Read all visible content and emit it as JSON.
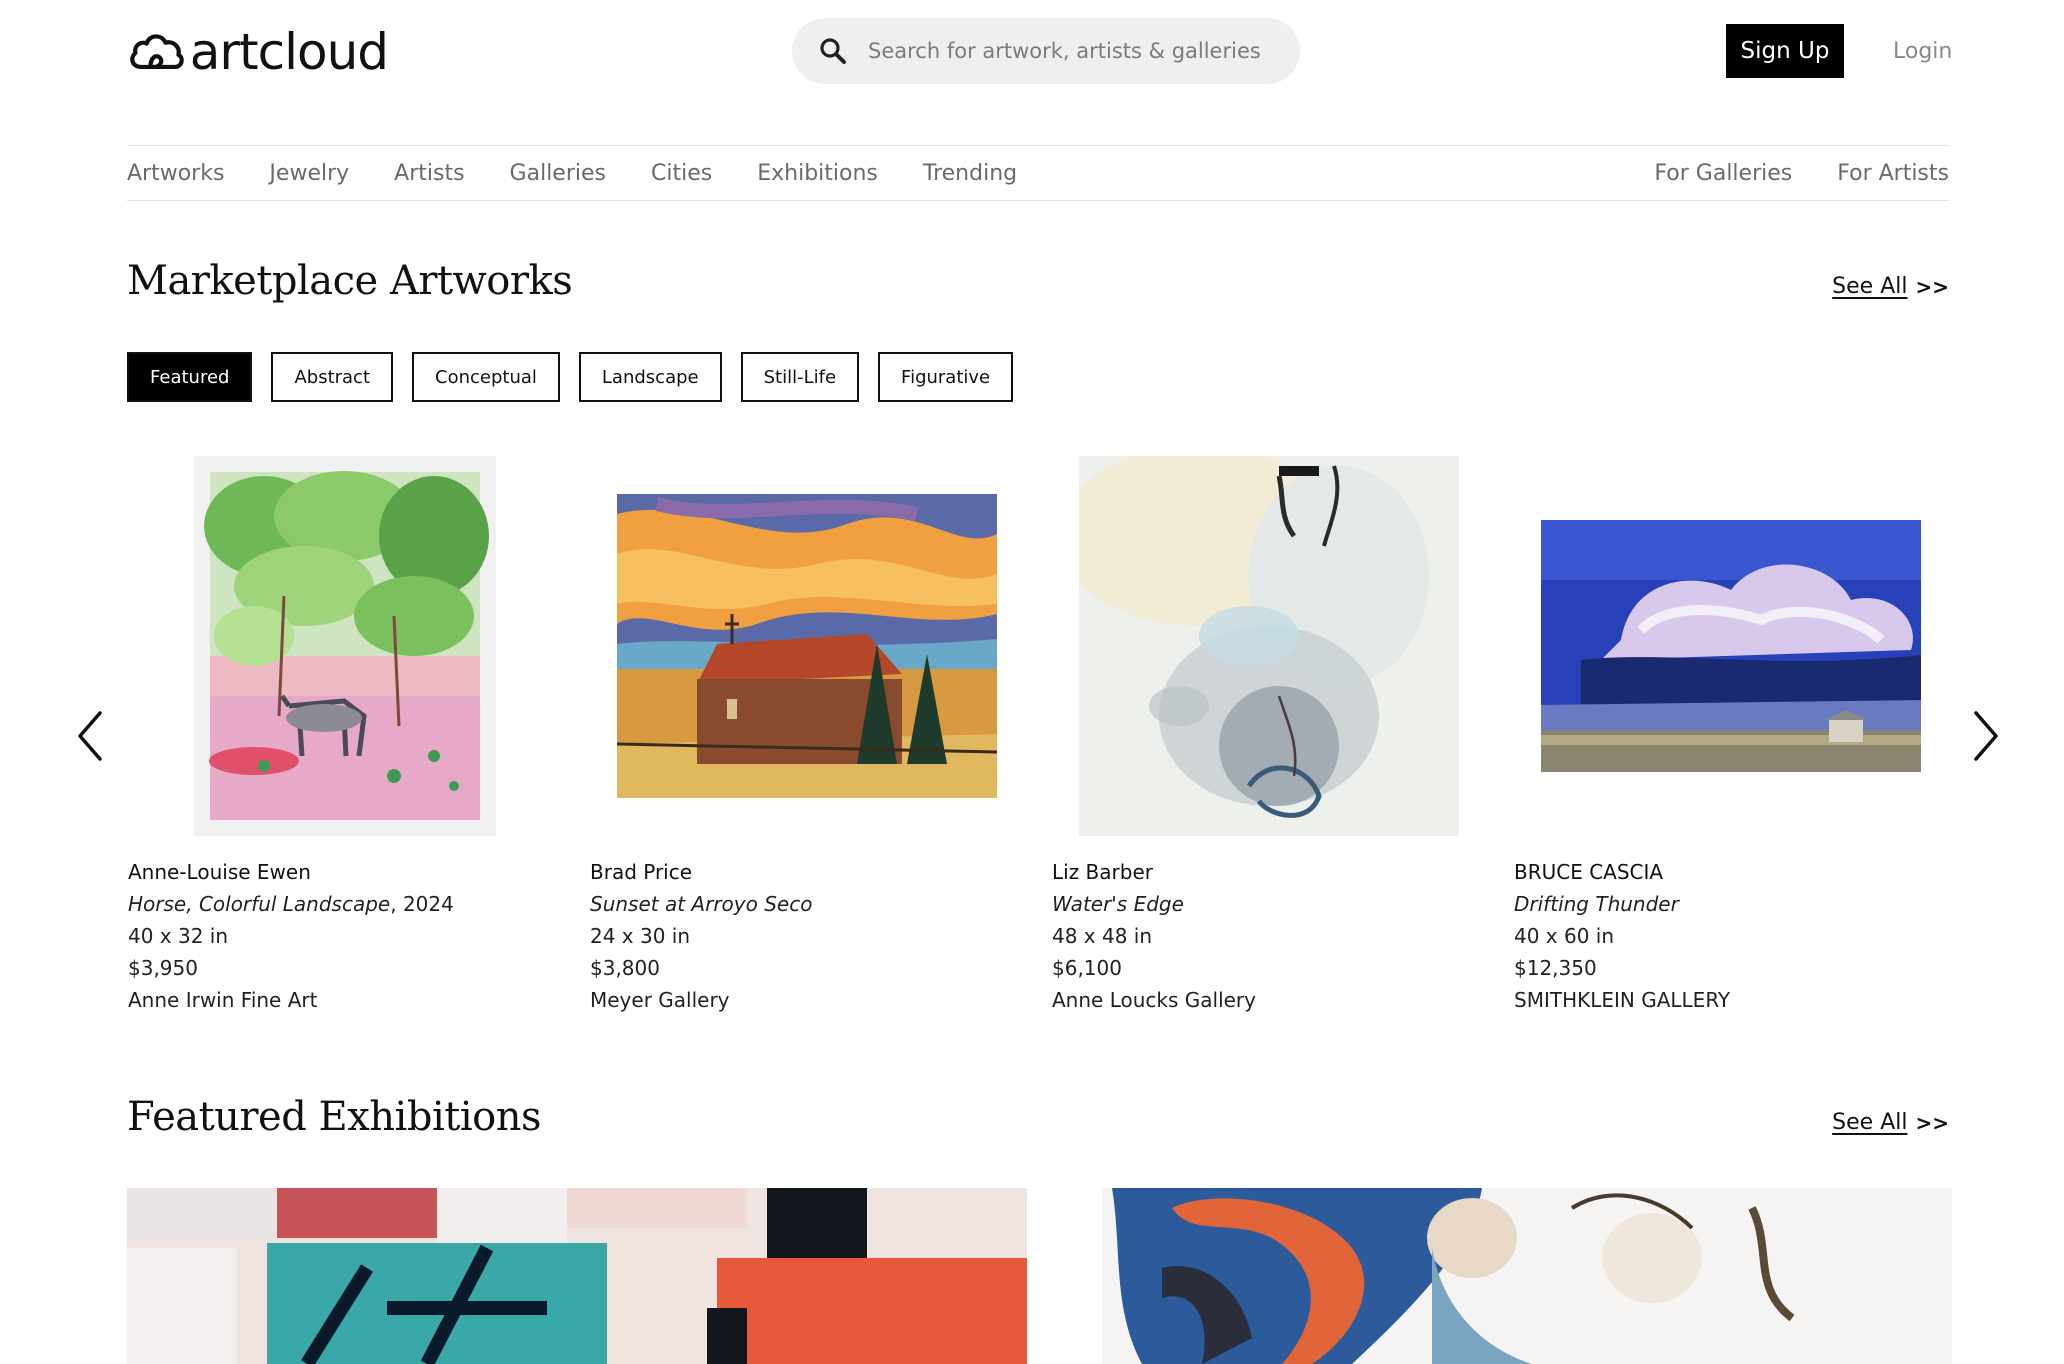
{
  "header": {
    "logo_text": "artcloud",
    "search": {
      "placeholder": "Search for artwork, artists & galleries"
    },
    "signup_label": "Sign Up",
    "login_label": "Login"
  },
  "nav": {
    "left": [
      "Artworks",
      "Jewelry",
      "Artists",
      "Galleries",
      "Cities",
      "Exhibitions",
      "Trending"
    ],
    "right": [
      "For Galleries",
      "For Artists"
    ]
  },
  "marketplace": {
    "title": "Marketplace Artworks",
    "see_all_label": "See All",
    "see_all_arrows": ">>",
    "filters": [
      {
        "label": "Featured",
        "active": true
      },
      {
        "label": "Abstract",
        "active": false
      },
      {
        "label": "Conceptual",
        "active": false
      },
      {
        "label": "Landscape",
        "active": false
      },
      {
        "label": "Still-Life",
        "active": false
      },
      {
        "label": "Figurative",
        "active": false
      }
    ],
    "artworks": [
      {
        "artist": "Anne-Louise Ewen",
        "title": "Horse, Colorful Landscape",
        "year": ", 2024",
        "size": "40 x 32 in",
        "price": "$3,950",
        "gallery": "Anne Irwin Fine Art"
      },
      {
        "artist": "Brad Price",
        "title": "Sunset at Arroyo Seco",
        "year": "",
        "size": "24 x 30 in",
        "price": "$3,800",
        "gallery": "Meyer Gallery"
      },
      {
        "artist": "Liz Barber",
        "title": "Water's Edge",
        "year": "",
        "size": "48 x 48 in",
        "price": "$6,100",
        "gallery": "Anne Loucks Gallery"
      },
      {
        "artist": "BRUCE CASCIA",
        "title": "Drifting Thunder",
        "year": "",
        "size": "40 x 60 in",
        "price": "$12,350",
        "gallery": "SMITHKLEIN GALLERY"
      }
    ]
  },
  "exhibitions": {
    "title": "Featured Exhibitions",
    "see_all_label": "See All",
    "see_all_arrows": ">>"
  },
  "colors": {
    "accent": "#000000",
    "nav_text": "#6a6a6a",
    "search_bg": "#efefef"
  }
}
